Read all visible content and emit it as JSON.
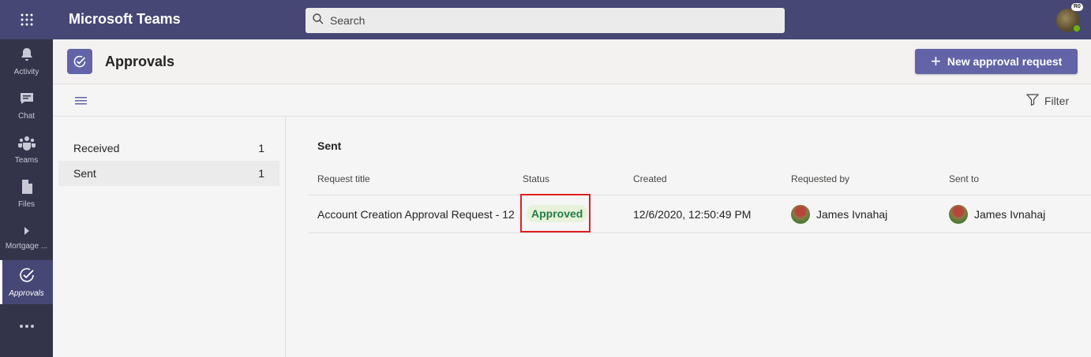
{
  "topbar": {
    "app_title": "Microsoft Teams",
    "search_placeholder": "Search",
    "profile_initials": "R0",
    "presence_color": "#6bb700"
  },
  "rail": {
    "items": [
      {
        "label": "Activity",
        "icon": "bell-icon"
      },
      {
        "label": "Chat",
        "icon": "chat-icon"
      },
      {
        "label": "Teams",
        "icon": "teams-icon"
      },
      {
        "label": "Files",
        "icon": "file-icon"
      },
      {
        "label": "Mortgage ...",
        "icon": "app-chevron-icon"
      },
      {
        "label": "Approvals",
        "icon": "approvals-icon",
        "active": true
      },
      {
        "label": "",
        "icon": "more-icon"
      }
    ]
  },
  "app_header": {
    "app_name": "Approvals",
    "new_button_label": "New approval request"
  },
  "toolbar": {
    "filter_label": "Filter"
  },
  "nav": {
    "items": [
      {
        "label": "Received",
        "count": "1"
      },
      {
        "label": "Sent",
        "count": "1",
        "selected": true
      }
    ]
  },
  "main": {
    "section_title": "Sent",
    "columns": [
      "Request title",
      "Status",
      "Created",
      "Requested by",
      "Sent to"
    ],
    "rows": [
      {
        "title": "Account Creation Approval Request - 12",
        "status": "Approved",
        "created": "12/6/2020, 12:50:49 PM",
        "requested_by": "James Ivnahaj",
        "sent_to": "James Ivnahaj"
      }
    ]
  },
  "colors": {
    "topbar": "#464775",
    "rail": "#33344a",
    "accent": "#6264a7",
    "approved_text": "#237b4b",
    "approved_bg": "#e7f2da",
    "highlight_border": "#e01e24"
  }
}
